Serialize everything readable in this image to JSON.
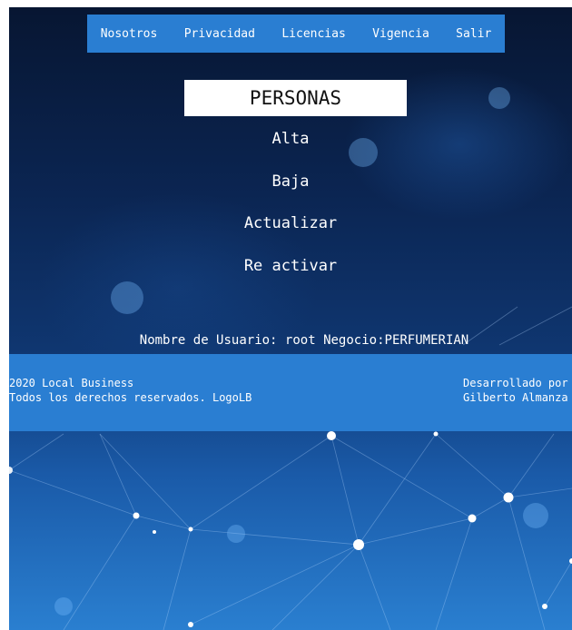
{
  "nav": {
    "items": [
      {
        "label": "Nosotros"
      },
      {
        "label": "Privacidad"
      },
      {
        "label": "Licencias"
      },
      {
        "label": "Vigencia"
      },
      {
        "label": "Salir"
      }
    ]
  },
  "page": {
    "title": "PERSONAS"
  },
  "menu": {
    "items": [
      {
        "label": "Alta"
      },
      {
        "label": "Baja"
      },
      {
        "label": "Actualizar"
      },
      {
        "label": "Re activar"
      }
    ]
  },
  "user": {
    "label": "Nombre de Usuario:",
    "username": "root",
    "business_label": "Negocio:",
    "business": "PERFUMERIAN"
  },
  "footer": {
    "line1": "2020 Local Business",
    "line2": "Todos los derechos reservados. LogoLB",
    "credit1": "Desarrollado por",
    "credit2": "Gilberto Almanza"
  },
  "colors": {
    "accent": "#2a7ed2",
    "background_dark": "#071632",
    "background_light": "#2a7fd0"
  }
}
